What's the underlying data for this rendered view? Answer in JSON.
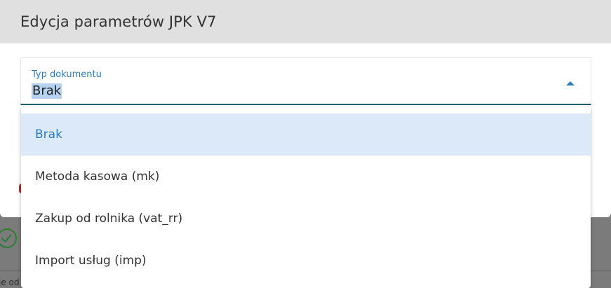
{
  "dialog": {
    "title": "Edycja parametrów JPK V7"
  },
  "field": {
    "label": "Typ dokumentu",
    "value": "Brak"
  },
  "dropdown": {
    "options": [
      {
        "label": "Brak",
        "selected": true
      },
      {
        "label": "Metoda kasowa (mk)",
        "selected": false
      },
      {
        "label": "Zakup od rolnika (vat_rr)",
        "selected": false
      },
      {
        "label": "Import usług (imp)",
        "selected": false
      }
    ]
  },
  "background": {
    "snippet": "je od"
  },
  "colors": {
    "accent": "#2b7bc0",
    "selected_bg": "#dce9f8",
    "header_bg": "#e0e0e0",
    "field_underline": "#1e5f74",
    "success": "#2e7d32",
    "error": "#c62828"
  }
}
